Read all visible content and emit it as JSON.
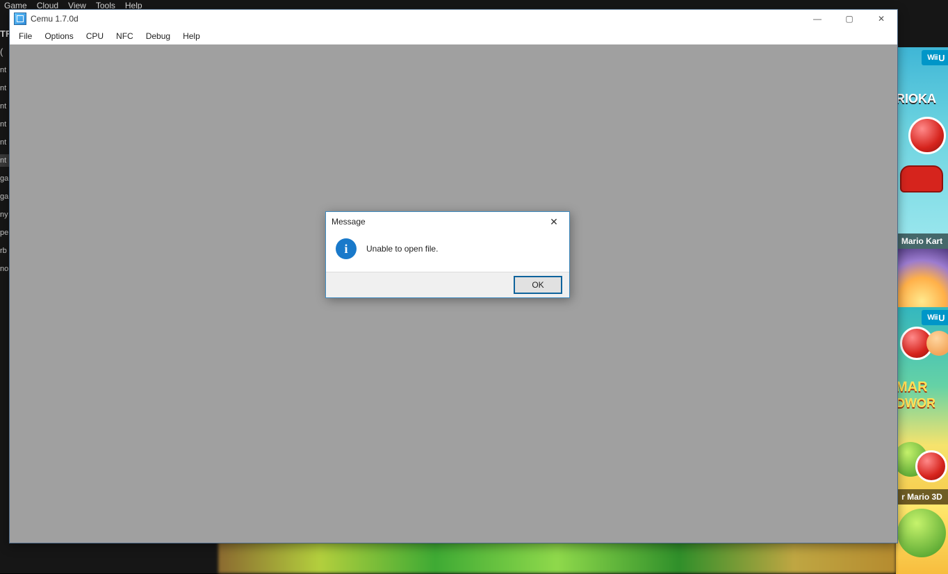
{
  "outer": {
    "menu": [
      "Game",
      "Cloud",
      "View",
      "Tools",
      "Help"
    ],
    "sidebar": {
      "header": "TF",
      "paren": "(",
      "items": [
        "nt",
        "nt",
        "nt",
        "nt",
        "nt",
        "nt",
        "ga",
        "ga",
        "ny",
        "pe",
        "rb",
        "no"
      ],
      "selected_index": 5
    }
  },
  "tiles": {
    "wiiu_label": "Wii",
    "wiiu_super": "U",
    "tile1": {
      "logo_text": "RIOKA",
      "title": "Mario Kart"
    },
    "tile3": {
      "logo_mar": "MAR",
      "logo_wor": "DWOR",
      "title": "r Mario 3D"
    }
  },
  "cemu": {
    "title": "Cemu 1.7.0d",
    "menu": [
      "File",
      "Options",
      "CPU",
      "NFC",
      "Debug",
      "Help"
    ],
    "winctrl": {
      "min": "—",
      "max": "▢",
      "close": "✕"
    }
  },
  "dialog": {
    "title": "Message",
    "text": "Unable to open file.",
    "info_glyph": "i",
    "ok": "OK",
    "close": "✕"
  }
}
